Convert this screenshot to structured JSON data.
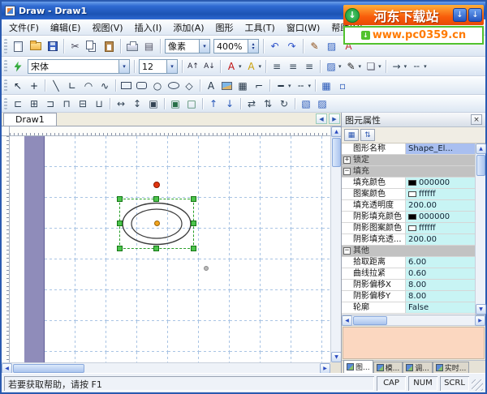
{
  "titlebar": {
    "title": "Draw - Draw1"
  },
  "watermark": {
    "site_name": "河东下载站",
    "site_url": "www.pc0359.cn"
  },
  "menu": {
    "items": [
      {
        "key": "file",
        "label": "文件(F)"
      },
      {
        "key": "edit",
        "label": "编辑(E)"
      },
      {
        "key": "view",
        "label": "视图(V)"
      },
      {
        "key": "insert",
        "label": "插入(I)"
      },
      {
        "key": "add",
        "label": "添加(A)"
      },
      {
        "key": "shape",
        "label": "图形"
      },
      {
        "key": "tools",
        "label": "工具(T)"
      },
      {
        "key": "window",
        "label": "窗口(W)"
      },
      {
        "key": "help",
        "label": "帮助(H)"
      }
    ]
  },
  "toolbars": {
    "standard": [
      {
        "t": "grip"
      },
      {
        "t": "btn",
        "n": "new",
        "i": "css:new"
      },
      {
        "t": "btn",
        "n": "open",
        "i": "css:open"
      },
      {
        "t": "btn",
        "n": "save",
        "i": "css:save"
      },
      {
        "t": "sep"
      },
      {
        "t": "btn",
        "n": "cut",
        "i": "✂",
        "c": "#445"
      },
      {
        "t": "btn",
        "n": "copy",
        "i": "css:copy"
      },
      {
        "t": "btn",
        "n": "paste",
        "i": "css:paste"
      },
      {
        "t": "sep"
      },
      {
        "t": "btn",
        "n": "print",
        "i": "css:print"
      },
      {
        "t": "btn",
        "n": "print-preview",
        "i": "▤",
        "c": "#556"
      },
      {
        "t": "sep"
      },
      {
        "t": "combo",
        "n": "units",
        "v": "像素",
        "w": 56
      },
      {
        "t": "spin",
        "n": "zoom",
        "v": "400%",
        "w": 56
      },
      {
        "t": "sep"
      },
      {
        "t": "btn",
        "n": "undo",
        "i": "↶",
        "c": "#2a50c8"
      },
      {
        "t": "btn",
        "n": "redo",
        "i": "↷",
        "c": "#2a50c8"
      },
      {
        "t": "sep"
      },
      {
        "t": "btn",
        "n": "pencil",
        "i": "✎",
        "c": "#8a4a10"
      },
      {
        "t": "btn",
        "n": "fill",
        "i": "▨",
        "c": "#3060c0"
      },
      {
        "t": "btn",
        "n": "text",
        "i": "A",
        "c": "#c03030"
      }
    ],
    "format": [
      {
        "t": "grip"
      },
      {
        "t": "btn",
        "n": "apply",
        "i": "css:bolt"
      },
      {
        "t": "combo",
        "n": "font-name",
        "v": "宋体",
        "w": 126
      },
      {
        "t": "sep"
      },
      {
        "t": "combo",
        "n": "font-size",
        "v": "12",
        "w": 48
      },
      {
        "t": "sep"
      },
      {
        "t": "btn",
        "n": "font-larger",
        "i": "A↑",
        "c": "#223"
      },
      {
        "t": "btn",
        "n": "font-smaller",
        "i": "A↓",
        "c": "#223"
      },
      {
        "t": "sep"
      },
      {
        "t": "btn",
        "n": "text-color",
        "i": "A",
        "c": "#c01010",
        "drop": 1
      },
      {
        "t": "btn",
        "n": "highlight-color",
        "i": "A",
        "c": "#caa008",
        "drop": 1
      },
      {
        "t": "sep"
      },
      {
        "t": "btn",
        "n": "align-left",
        "i": "≡",
        "c": "#345"
      },
      {
        "t": "btn",
        "n": "align-center",
        "i": "≡",
        "c": "#345"
      },
      {
        "t": "btn",
        "n": "align-right",
        "i": "≡",
        "c": "#345"
      },
      {
        "t": "sep"
      },
      {
        "t": "btn",
        "n": "fill-color",
        "i": "▨",
        "c": "#2858b8",
        "drop": 1
      },
      {
        "t": "btn",
        "n": "line-color",
        "i": "✎",
        "c": "#222",
        "drop": 1
      },
      {
        "t": "btn",
        "n": "shadow-style",
        "i": "❏",
        "c": "#556",
        "drop": 1
      },
      {
        "t": "sep"
      },
      {
        "t": "btn",
        "n": "arrow-style",
        "i": "→",
        "c": "#345",
        "drop": 1
      },
      {
        "t": "btn",
        "n": "line-style",
        "i": "╌",
        "c": "#345",
        "drop": 1
      }
    ],
    "draw": [
      {
        "t": "grip"
      },
      {
        "t": "btn",
        "n": "select-tool",
        "i": "↖",
        "c": "#123"
      },
      {
        "t": "btn",
        "n": "node-edit-tool",
        "i": "+",
        "c": "#123"
      },
      {
        "t": "sep"
      },
      {
        "t": "btn",
        "n": "line-tool",
        "i": "╲",
        "c": "#234"
      },
      {
        "t": "btn",
        "n": "polyline-tool",
        "i": "∟",
        "c": "#234"
      },
      {
        "t": "btn",
        "n": "arc-tool",
        "i": "◠",
        "c": "#234"
      },
      {
        "t": "btn",
        "n": "curve-tool",
        "i": "∿",
        "c": "#234"
      },
      {
        "t": "sep"
      },
      {
        "t": "btn",
        "n": "rect-tool",
        "i": "css:rect"
      },
      {
        "t": "btn",
        "n": "rounded-rect-tool",
        "i": "css:rrect"
      },
      {
        "t": "btn",
        "n": "circle-tool",
        "i": "○",
        "c": "#234"
      },
      {
        "t": "btn",
        "n": "ellipse-tool",
        "i": "css:ellipse"
      },
      {
        "t": "btn",
        "n": "polygon-tool",
        "i": "◇",
        "c": "#234"
      },
      {
        "t": "sep"
      },
      {
        "t": "btn",
        "n": "text-tool",
        "i": "A",
        "c": "#234"
      },
      {
        "t": "btn",
        "n": "image-tool",
        "i": "css:img"
      },
      {
        "t": "btn",
        "n": "table-tool",
        "i": "▦",
        "c": "#234"
      },
      {
        "t": "btn",
        "n": "connector-tool",
        "i": "⌐",
        "c": "#234"
      },
      {
        "t": "sep"
      },
      {
        "t": "btn",
        "n": "line-width",
        "i": "━",
        "c": "#234",
        "drop": 1
      },
      {
        "t": "btn",
        "n": "dash-style",
        "i": "╌",
        "c": "#234",
        "drop": 1
      },
      {
        "t": "sep"
      },
      {
        "t": "btn",
        "n": "grid-toggle",
        "i": "▦",
        "c": "#2858b8"
      },
      {
        "t": "btn",
        "n": "snap-toggle",
        "i": "▫",
        "c": "#2858b8"
      }
    ],
    "arrange": [
      {
        "t": "grip"
      },
      {
        "t": "btn",
        "n": "align-lefts",
        "i": "⊏",
        "c": "#345"
      },
      {
        "t": "btn",
        "n": "align-centers",
        "i": "⊞",
        "c": "#345"
      },
      {
        "t": "btn",
        "n": "align-rights",
        "i": "⊐",
        "c": "#345"
      },
      {
        "t": "btn",
        "n": "align-tops",
        "i": "⊓",
        "c": "#345"
      },
      {
        "t": "btn",
        "n": "align-middles",
        "i": "⊟",
        "c": "#345"
      },
      {
        "t": "btn",
        "n": "align-bottoms",
        "i": "⊔",
        "c": "#345"
      },
      {
        "t": "sep"
      },
      {
        "t": "btn",
        "n": "same-width",
        "i": "↔",
        "c": "#345"
      },
      {
        "t": "btn",
        "n": "same-height",
        "i": "↕",
        "c": "#345"
      },
      {
        "t": "btn",
        "n": "same-size",
        "i": "▣",
        "c": "#345"
      },
      {
        "t": "sep"
      },
      {
        "t": "btn",
        "n": "group",
        "i": "▣",
        "c": "#287048"
      },
      {
        "t": "btn",
        "n": "ungroup",
        "i": "□",
        "c": "#287048"
      },
      {
        "t": "sep"
      },
      {
        "t": "btn",
        "n": "bring-to-front",
        "i": "↑",
        "c": "#2858b8"
      },
      {
        "t": "btn",
        "n": "send-to-back",
        "i": "↓",
        "c": "#2858b8"
      },
      {
        "t": "sep"
      },
      {
        "t": "btn",
        "n": "flip-horizontal",
        "i": "⇄",
        "c": "#345"
      },
      {
        "t": "btn",
        "n": "flip-vertical",
        "i": "⇅",
        "c": "#345"
      },
      {
        "t": "btn",
        "n": "rotate",
        "i": "↻",
        "c": "#345"
      },
      {
        "t": "sep"
      },
      {
        "t": "btn",
        "n": "layers-panel-toggle",
        "i": "▧",
        "c": "#2858b8"
      },
      {
        "t": "btn",
        "n": "properties-panel-toggle",
        "i": "▨",
        "c": "#2858b8"
      }
    ]
  },
  "document_tabs": {
    "active": "Draw1"
  },
  "properties_panel": {
    "title": "图元属性",
    "rows": [
      {
        "type": "prop",
        "label": "图形名称",
        "value": "Shape_El...",
        "selected": true
      },
      {
        "type": "category",
        "label": "锁定",
        "collapsed": true
      },
      {
        "type": "category",
        "label": "填充",
        "collapsed": false
      },
      {
        "type": "prop",
        "label": "填充颜色",
        "swatch": "#000000",
        "value": "000000"
      },
      {
        "type": "prop",
        "label": "图案颜色",
        "swatch": "#ffffff",
        "value": "ffffff"
      },
      {
        "type": "prop",
        "label": "填充透明度",
        "value": "200.00"
      },
      {
        "type": "prop",
        "label": "阴影填充颜色",
        "swatch": "#000000",
        "value": "000000"
      },
      {
        "type": "prop",
        "label": "阴影图案颜色",
        "swatch": "#ffffff",
        "value": "ffffff"
      },
      {
        "type": "prop",
        "label": "阴影填充透...",
        "value": "200.00"
      },
      {
        "type": "category",
        "label": "其他",
        "collapsed": false
      },
      {
        "type": "prop",
        "label": "拾取距离",
        "value": "6.00"
      },
      {
        "type": "prop",
        "label": "曲线拉紧",
        "value": "0.60"
      },
      {
        "type": "prop",
        "label": "阴影偏移X",
        "value": "8.00"
      },
      {
        "type": "prop",
        "label": "阴影偏移Y",
        "value": "8.00"
      },
      {
        "type": "prop",
        "label": "轮廓",
        "value": "False"
      }
    ]
  },
  "panel_tabs": {
    "items": [
      "图...",
      "模...",
      "调...",
      "实时..."
    ],
    "active_index": 0
  },
  "statusbar": {
    "message": "若要获取帮助，请按 F1",
    "indicators": [
      "CAP",
      "NUM",
      "SCRL"
    ]
  },
  "colors": {
    "titlebar_blue": "#2f6ad2",
    "watermark_orange": "#f85c0a",
    "watermark_green": "#52c22e",
    "selection_green": "#4cc44c",
    "rotation_handle_red": "#e23410",
    "center_point_orange": "#f2a41e",
    "value_cell_cyan": "#c8f4f4",
    "description_area_peach": "#fbd7c0",
    "canvas_band_purple": "#8f8cba",
    "grid_line_blue": "#a9c4e4",
    "fill_color_value": "#000000",
    "pattern_color_value": "#ffffff"
  }
}
